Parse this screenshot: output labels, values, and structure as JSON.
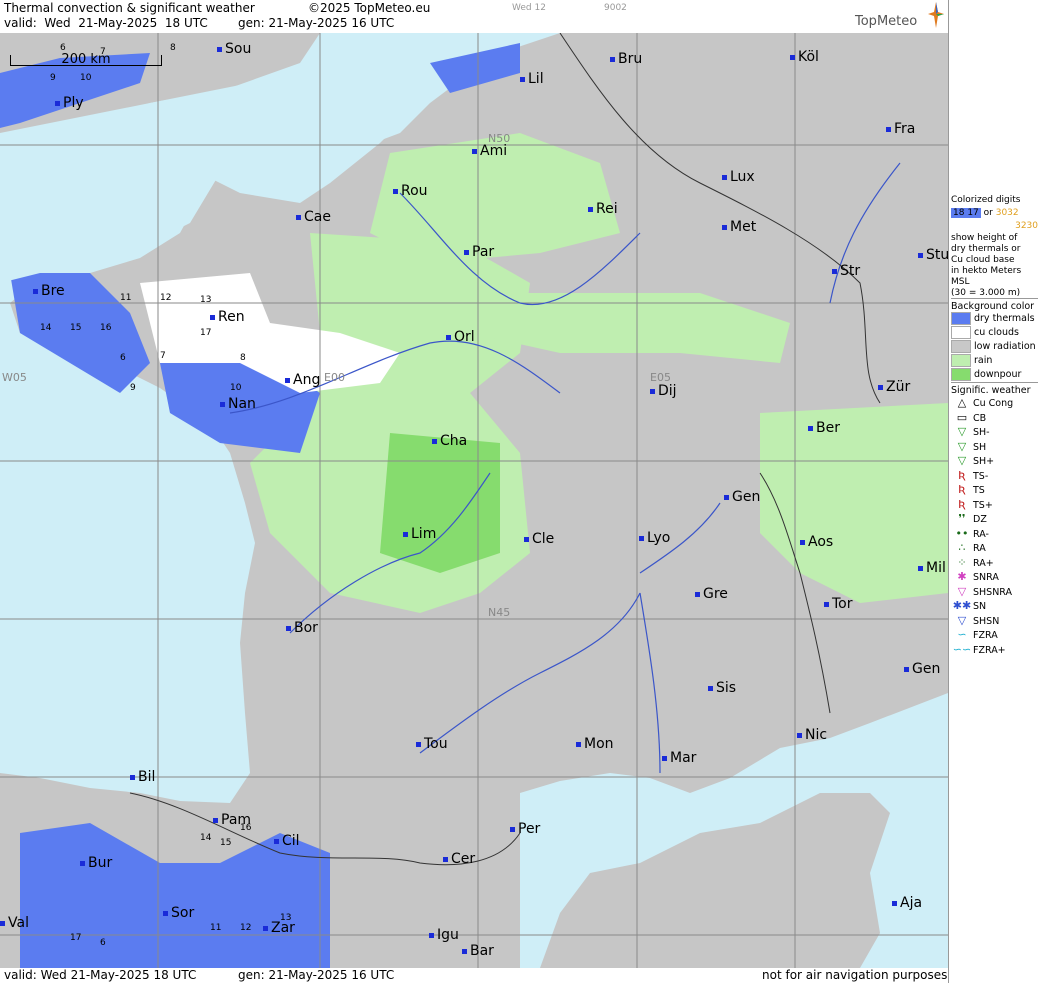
{
  "header": {
    "title": "Thermal convection & significant weather",
    "copyright": "©2025 TopMeteo.eu",
    "tab_day": "Wed 12",
    "tab_code": "9002",
    "valid": "valid:  Wed  21-May-2025  18 UTC",
    "gen": "gen: 21-May-2025 16 UTC",
    "logo": "TopMeteo"
  },
  "footer": {
    "valid": "valid:  Wed  21-May-2025  18 UTC",
    "gen": "gen: 21-May-2025 16 UTC",
    "disclaimer": "not for air navigation purposes"
  },
  "map": {
    "scale_label": "200 km",
    "grid_labels": [
      "W05",
      "E00",
      "E05",
      "N50",
      "N45"
    ],
    "cities": [
      "Ply",
      "Sou",
      "Bru",
      "Köl",
      "Lil",
      "Ami",
      "Fra",
      "Rou",
      "Lux",
      "Cae",
      "Rei",
      "Met",
      "Par",
      "Str",
      "Stu",
      "Bre",
      "Ren",
      "Orl",
      "Ang",
      "Nan",
      "Dij",
      "Zür",
      "Cha",
      "Ber",
      "Gen",
      "Lim",
      "Cle",
      "Lyo",
      "Aos",
      "Mil",
      "Gre",
      "Tor",
      "Bor",
      "Gen",
      "Sis",
      "Nic",
      "Tou",
      "Mon",
      "Mar",
      "Bil",
      "Pam",
      "Per",
      "Cil",
      "Bur",
      "Cer",
      "Sor",
      "Zar",
      "Aja",
      "Val",
      "Igu",
      "Bar"
    ],
    "thermal_values": [
      "6",
      "7",
      "8",
      "9",
      "10",
      "11",
      "12",
      "13",
      "14",
      "15",
      "16",
      "17"
    ]
  },
  "legend": {
    "colorized_title": "Colorized digits",
    "digit_examples": [
      "18 17",
      "3032",
      "3230"
    ],
    "or": "or",
    "explain": [
      "show height of",
      "dry thermals or",
      "Cu cloud base",
      "in hekto Meters",
      "MSL",
      "(30 = 3.000 m)"
    ],
    "background_title": "Background color",
    "background_items": [
      {
        "label": "dry thermals",
        "color": "#5b7cf0"
      },
      {
        "label": "cu clouds",
        "color": "#ffffff"
      },
      {
        "label": "low radiation",
        "color": "#c8c8c8"
      },
      {
        "label": "rain",
        "color": "#bfeeb0"
      },
      {
        "label": "downpour",
        "color": "#86dc6e"
      }
    ],
    "weather_title": "Signific. weather",
    "weather_items": [
      {
        "label": "Cu Cong",
        "icon": "△"
      },
      {
        "label": "CB",
        "icon": "▭"
      },
      {
        "label": "SH-",
        "icon": "▽"
      },
      {
        "label": "SH",
        "icon": "▽"
      },
      {
        "label": "SH+",
        "icon": "▽"
      },
      {
        "label": "TS-",
        "icon": "Ʀ"
      },
      {
        "label": "TS",
        "icon": "Ʀ"
      },
      {
        "label": "TS+",
        "icon": "Ʀ"
      },
      {
        "label": "DZ",
        "icon": "❜❜"
      },
      {
        "label": "RA-",
        "icon": "••"
      },
      {
        "label": "RA",
        "icon": "∴"
      },
      {
        "label": "RA+",
        "icon": "⁘"
      },
      {
        "label": "SNRA",
        "icon": "✱"
      },
      {
        "label": "SHSNRA",
        "icon": "▽"
      },
      {
        "label": "SN",
        "icon": "✱✱"
      },
      {
        "label": "SHSN",
        "icon": "▽"
      },
      {
        "label": "FZRA",
        "icon": "∽"
      },
      {
        "label": "FZRA+",
        "icon": "∽∽"
      }
    ]
  }
}
